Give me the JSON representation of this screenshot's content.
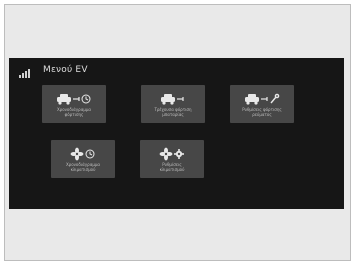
{
  "header": {
    "title": "Μενού EV"
  },
  "tiles": [
    {
      "id": "tile-1",
      "icons": [
        "car-icon",
        "plug-icon",
        "clock-icon"
      ],
      "label1": "Χρονοδιάγραμμα",
      "label2": "φόρτισης"
    },
    {
      "id": "tile-2",
      "icons": [
        "car-icon",
        "plug-icon"
      ],
      "label1": "Τρέχουσα φόρτιση",
      "label2": "μπαταρίας"
    },
    {
      "id": "tile-3",
      "icons": [
        "car-icon",
        "plug-icon",
        "wrench-icon"
      ],
      "label1": "Ρυθμίσεις φόρτισης",
      "label2": "ρεύματος"
    },
    {
      "id": "tile-4",
      "icons": [
        "fan-icon",
        "clock-icon"
      ],
      "label1": "Χρονοδιάγραμμα",
      "label2": "κλιματισμού"
    },
    {
      "id": "tile-5",
      "icons": [
        "fan-icon",
        "gear-icon"
      ],
      "label1": "Ρυθμίσεις",
      "label2": "κλιματισμού"
    }
  ],
  "colors": {
    "screen_bg": "#161616",
    "tile_bg": "#474747",
    "text": "#bdbdbd"
  }
}
